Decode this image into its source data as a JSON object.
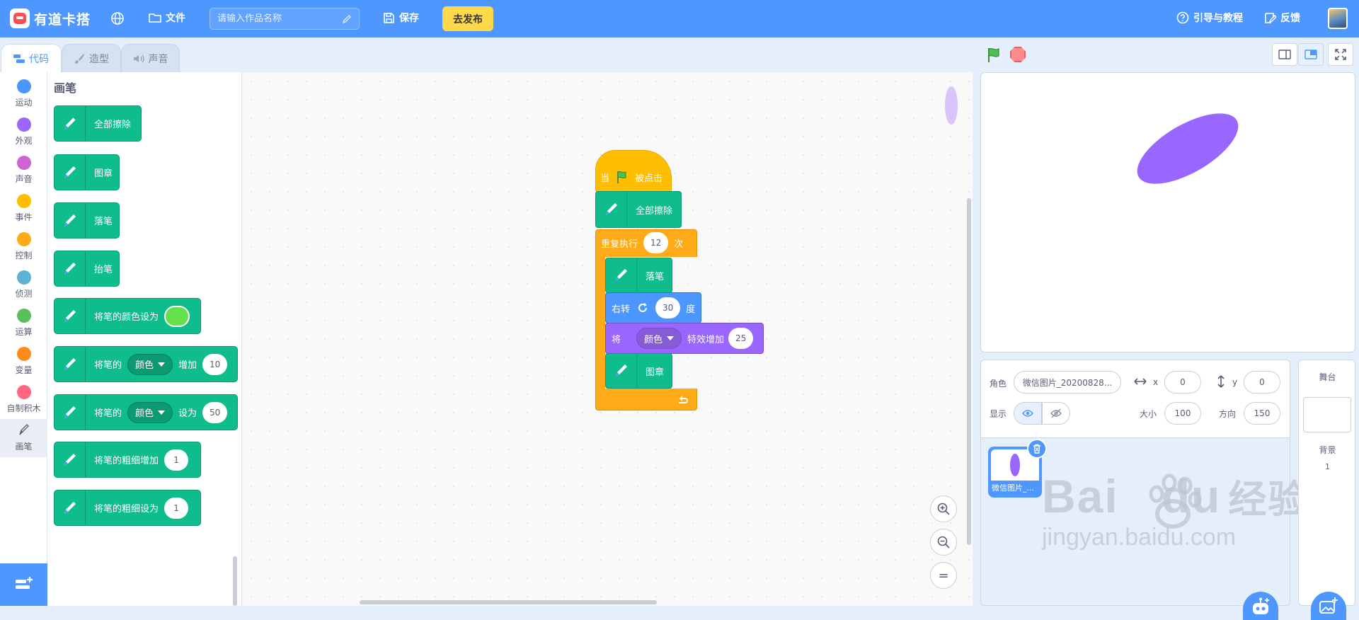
{
  "app": {
    "name": "有道卡搭"
  },
  "toolbar": {
    "file_label": "文件",
    "project_name_placeholder": "请输入作品名称",
    "save_label": "保存",
    "publish_label": "去发布",
    "guide_label": "引导与教程",
    "feedback_label": "反馈"
  },
  "tabs": [
    {
      "label": "代码",
      "active": true
    },
    {
      "label": "造型",
      "active": false
    },
    {
      "label": "声音",
      "active": false
    }
  ],
  "categories": [
    {
      "label": "运动",
      "color": "#4c97ff"
    },
    {
      "label": "外观",
      "color": "#9966ff"
    },
    {
      "label": "声音",
      "color": "#cf63cf"
    },
    {
      "label": "事件",
      "color": "#ffbf00"
    },
    {
      "label": "控制",
      "color": "#ffab19"
    },
    {
      "label": "侦测",
      "color": "#5cb1d6"
    },
    {
      "label": "运算",
      "color": "#59c059"
    },
    {
      "label": "变量",
      "color": "#ff8c1a"
    },
    {
      "label": "自制积木",
      "color": "#ff6680"
    },
    {
      "label": "画笔",
      "color": "#0fbd8c",
      "selected": true
    }
  ],
  "palette": {
    "title": "画笔",
    "blocks": {
      "clear": "全部擦除",
      "stamp": "图章",
      "pen_down": "落笔",
      "pen_up": "抬笔",
      "set_color_to": "将笔的颜色设为",
      "change_param_prefix": "将笔的",
      "change_param_dropdown": "颜色",
      "change_param_by": "增加",
      "change_param_value": "10",
      "set_param_prefix": "将笔的",
      "set_param_dropdown": "颜色",
      "set_param_to": "设为",
      "set_param_value": "50",
      "change_size": "将笔的粗细增加",
      "change_size_value": "1",
      "set_size": "将笔的粗细设为",
      "set_size_value": "1"
    }
  },
  "script": {
    "hat_when": "当",
    "hat_clicked": "被点击",
    "clear": "全部擦除",
    "repeat_label": "重复执行",
    "repeat_count": "12",
    "repeat_times": "次",
    "pen_down": "落笔",
    "turn_label": "右转",
    "turn_degrees": "30",
    "turn_unit": "度",
    "effect_prefix": "将",
    "effect_dropdown": "颜色",
    "effect_label": "特效增加",
    "effect_value": "25",
    "stamp": "图章"
  },
  "zoom": {
    "in": "+",
    "out": "−",
    "reset": "="
  },
  "sprite_info": {
    "sprite_label": "角色",
    "sprite_name": "微信图片_20200828...",
    "x_label": "x",
    "x_value": "0",
    "y_label": "y",
    "y_value": "0",
    "show_label": "显示",
    "size_label": "大小",
    "size_value": "100",
    "direction_label": "方向",
    "direction_value": "150"
  },
  "sprite_list": [
    {
      "name": "微信图片_...",
      "selected": true
    }
  ],
  "stage_panel": {
    "title": "舞台",
    "backdrop_label": "背景",
    "backdrop_count": "1"
  },
  "watermark": {
    "brand": "Bai",
    "brand_tail": "du",
    "cn": "经验",
    "url": "jingyan.baidu.com"
  },
  "colors": {
    "topbar": "#4d97ff",
    "publish": "#ffd94a",
    "pen_block": "#0fbd8c",
    "event_block": "#ffbf00",
    "control_block": "#ffab19",
    "motion_block": "#4c97ff",
    "looks_block": "#9966ff",
    "sprite_fill": "#9966ff"
  }
}
